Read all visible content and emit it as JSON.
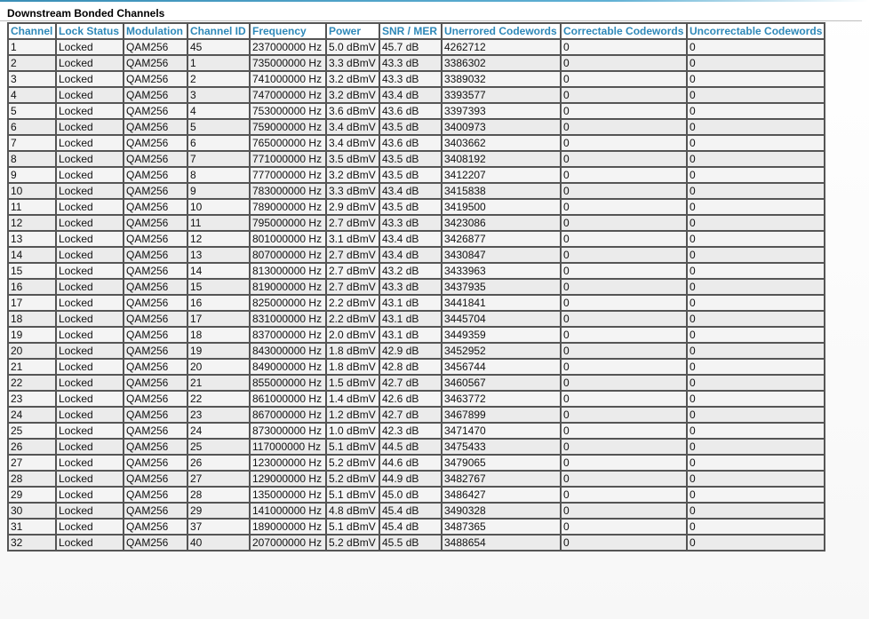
{
  "section": {
    "title": "Downstream Bonded Channels"
  },
  "table": {
    "headers": [
      "Channel",
      "Lock Status",
      "Modulation",
      "Channel ID",
      "Frequency",
      "Power",
      "SNR / MER",
      "Unerrored Codewords",
      "Correctable Codewords",
      "Uncorrectable Codewords"
    ],
    "rows": [
      [
        "1",
        "Locked",
        "QAM256",
        "45",
        "237000000 Hz",
        "5.0 dBmV",
        "45.7 dB",
        "4262712",
        "0",
        "0"
      ],
      [
        "2",
        "Locked",
        "QAM256",
        "1",
        "735000000 Hz",
        "3.3 dBmV",
        "43.3 dB",
        "3386302",
        "0",
        "0"
      ],
      [
        "3",
        "Locked",
        "QAM256",
        "2",
        "741000000 Hz",
        "3.2 dBmV",
        "43.3 dB",
        "3389032",
        "0",
        "0"
      ],
      [
        "4",
        "Locked",
        "QAM256",
        "3",
        "747000000 Hz",
        "3.2 dBmV",
        "43.4 dB",
        "3393577",
        "0",
        "0"
      ],
      [
        "5",
        "Locked",
        "QAM256",
        "4",
        "753000000 Hz",
        "3.6 dBmV",
        "43.6 dB",
        "3397393",
        "0",
        "0"
      ],
      [
        "6",
        "Locked",
        "QAM256",
        "5",
        "759000000 Hz",
        "3.4 dBmV",
        "43.5 dB",
        "3400973",
        "0",
        "0"
      ],
      [
        "7",
        "Locked",
        "QAM256",
        "6",
        "765000000 Hz",
        "3.4 dBmV",
        "43.6 dB",
        "3403662",
        "0",
        "0"
      ],
      [
        "8",
        "Locked",
        "QAM256",
        "7",
        "771000000 Hz",
        "3.5 dBmV",
        "43.5 dB",
        "3408192",
        "0",
        "0"
      ],
      [
        "9",
        "Locked",
        "QAM256",
        "8",
        "777000000 Hz",
        "3.2 dBmV",
        "43.5 dB",
        "3412207",
        "0",
        "0"
      ],
      [
        "10",
        "Locked",
        "QAM256",
        "9",
        "783000000 Hz",
        "3.3 dBmV",
        "43.4 dB",
        "3415838",
        "0",
        "0"
      ],
      [
        "11",
        "Locked",
        "QAM256",
        "10",
        "789000000 Hz",
        "2.9 dBmV",
        "43.5 dB",
        "3419500",
        "0",
        "0"
      ],
      [
        "12",
        "Locked",
        "QAM256",
        "11",
        "795000000 Hz",
        "2.7 dBmV",
        "43.3 dB",
        "3423086",
        "0",
        "0"
      ],
      [
        "13",
        "Locked",
        "QAM256",
        "12",
        "801000000 Hz",
        "3.1 dBmV",
        "43.4 dB",
        "3426877",
        "0",
        "0"
      ],
      [
        "14",
        "Locked",
        "QAM256",
        "13",
        "807000000 Hz",
        "2.7 dBmV",
        "43.4 dB",
        "3430847",
        "0",
        "0"
      ],
      [
        "15",
        "Locked",
        "QAM256",
        "14",
        "813000000 Hz",
        "2.7 dBmV",
        "43.2 dB",
        "3433963",
        "0",
        "0"
      ],
      [
        "16",
        "Locked",
        "QAM256",
        "15",
        "819000000 Hz",
        "2.7 dBmV",
        "43.3 dB",
        "3437935",
        "0",
        "0"
      ],
      [
        "17",
        "Locked",
        "QAM256",
        "16",
        "825000000 Hz",
        "2.2 dBmV",
        "43.1 dB",
        "3441841",
        "0",
        "0"
      ],
      [
        "18",
        "Locked",
        "QAM256",
        "17",
        "831000000 Hz",
        "2.2 dBmV",
        "43.1 dB",
        "3445704",
        "0",
        "0"
      ],
      [
        "19",
        "Locked",
        "QAM256",
        "18",
        "837000000 Hz",
        "2.0 dBmV",
        "43.1 dB",
        "3449359",
        "0",
        "0"
      ],
      [
        "20",
        "Locked",
        "QAM256",
        "19",
        "843000000 Hz",
        "1.8 dBmV",
        "42.9 dB",
        "3452952",
        "0",
        "0"
      ],
      [
        "21",
        "Locked",
        "QAM256",
        "20",
        "849000000 Hz",
        "1.8 dBmV",
        "42.8 dB",
        "3456744",
        "0",
        "0"
      ],
      [
        "22",
        "Locked",
        "QAM256",
        "21",
        "855000000 Hz",
        "1.5 dBmV",
        "42.7 dB",
        "3460567",
        "0",
        "0"
      ],
      [
        "23",
        "Locked",
        "QAM256",
        "22",
        "861000000 Hz",
        "1.4 dBmV",
        "42.6 dB",
        "3463772",
        "0",
        "0"
      ],
      [
        "24",
        "Locked",
        "QAM256",
        "23",
        "867000000 Hz",
        "1.2 dBmV",
        "42.7 dB",
        "3467899",
        "0",
        "0"
      ],
      [
        "25",
        "Locked",
        "QAM256",
        "24",
        "873000000 Hz",
        "1.0 dBmV",
        "42.3 dB",
        "3471470",
        "0",
        "0"
      ],
      [
        "26",
        "Locked",
        "QAM256",
        "25",
        "117000000 Hz",
        "5.1 dBmV",
        "44.5 dB",
        "3475433",
        "0",
        "0"
      ],
      [
        "27",
        "Locked",
        "QAM256",
        "26",
        "123000000 Hz",
        "5.2 dBmV",
        "44.6 dB",
        "3479065",
        "0",
        "0"
      ],
      [
        "28",
        "Locked",
        "QAM256",
        "27",
        "129000000 Hz",
        "5.2 dBmV",
        "44.9 dB",
        "3482767",
        "0",
        "0"
      ],
      [
        "29",
        "Locked",
        "QAM256",
        "28",
        "135000000 Hz",
        "5.1 dBmV",
        "45.0 dB",
        "3486427",
        "0",
        "0"
      ],
      [
        "30",
        "Locked",
        "QAM256",
        "29",
        "141000000 Hz",
        "4.8 dBmV",
        "45.4 dB",
        "3490328",
        "0",
        "0"
      ],
      [
        "31",
        "Locked",
        "QAM256",
        "37",
        "189000000 Hz",
        "5.1 dBmV",
        "45.4 dB",
        "3487365",
        "0",
        "0"
      ],
      [
        "32",
        "Locked",
        "QAM256",
        "40",
        "207000000 Hz",
        "5.2 dBmV",
        "45.5 dB",
        "3488654",
        "0",
        "0"
      ]
    ]
  },
  "colors": {
    "header_text": "#2e88b8",
    "accent_rule": "#3a8fb7",
    "row_odd": "#f4f4f4",
    "row_even": "#ebebeb",
    "grid": "#555555"
  }
}
